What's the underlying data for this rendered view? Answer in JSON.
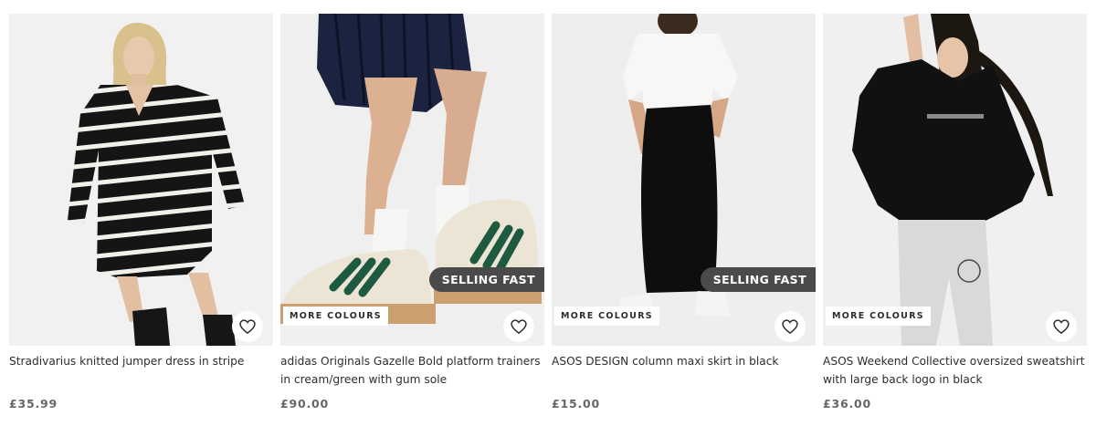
{
  "products": [
    {
      "title": "Stradivarius knitted jumper dress in stripe",
      "price": "£35.99",
      "badge": "",
      "more_colours": "",
      "image_icon": "model-striped-jumper-dress-photo",
      "save_icon": "heart-icon"
    },
    {
      "title": "adidas Originals Gazelle Bold platform trainers in cream/green with gum sole",
      "price": "£90.00",
      "badge": "SELLING FAST",
      "more_colours": "MORE COLOURS",
      "image_icon": "trainers-on-feet-photo",
      "save_icon": "heart-icon"
    },
    {
      "title": "ASOS DESIGN column maxi skirt in black",
      "price": "£15.00",
      "badge": "SELLING FAST",
      "more_colours": "MORE COLOURS",
      "image_icon": "model-black-maxi-skirt-photo",
      "save_icon": "heart-icon"
    },
    {
      "title": "ASOS Weekend Collective oversized sweatshirt with large back logo in black",
      "price": "£36.00",
      "badge": "",
      "more_colours": "MORE COLOURS",
      "image_icon": "model-black-sweatshirt-photo",
      "save_icon": "heart-icon"
    }
  ],
  "colors": {
    "badge_bg": "#4a4a4a",
    "text": "#2d2d2d",
    "price": "#666666"
  }
}
